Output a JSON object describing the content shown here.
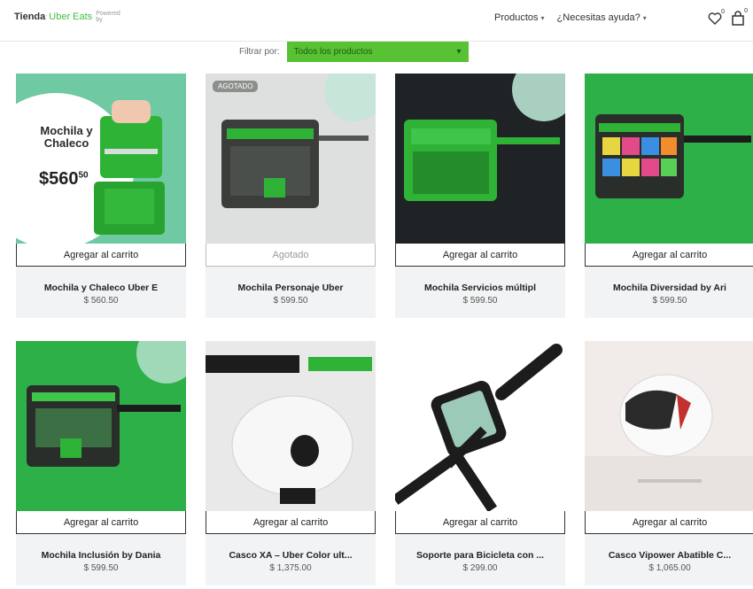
{
  "header": {
    "logo_brand": "Tienda",
    "logo_accent": "Uber Eats",
    "logo_tag": "Powered by",
    "nav": [
      {
        "label": "Productos"
      },
      {
        "label": "¿Necesitas ayuda?"
      }
    ],
    "cart_count": "0"
  },
  "filter": {
    "label": "Filtrar por:",
    "value": "Todos los productos"
  },
  "products": [
    {
      "name": "Mochila y Chaleco Uber E",
      "price": "$ 560.50",
      "button": "Agregar al carrito",
      "disabled": false,
      "badge": "",
      "poster_title": "Mochila y Chaleco",
      "poster_price": "$560",
      "poster_cents": "50"
    },
    {
      "name": "Mochila Personaje Uber",
      "price": "$ 599.50",
      "button": "Agotado",
      "disabled": true,
      "badge": "AGOTADO"
    },
    {
      "name": "Mochila Servicios múltipl",
      "price": "$ 599.50",
      "button": "Agregar al carrito",
      "disabled": false,
      "badge": ""
    },
    {
      "name": "Mochila Diversidad by Ari",
      "price": "$ 599.50",
      "button": "Agregar al carrito",
      "disabled": false,
      "badge": ""
    },
    {
      "name": "Mochila Inclusión by Dania",
      "price": "$ 599.50",
      "button": "Agregar al carrito",
      "disabled": false,
      "badge": ""
    },
    {
      "name": "Casco XA – Uber Color ult...",
      "price": "$ 1,375.00",
      "button": "Agregar al carrito",
      "disabled": false,
      "badge": ""
    },
    {
      "name": "Soporte para Bicicleta con ...",
      "price": "$ 299.00",
      "button": "Agregar al carrito",
      "disabled": false,
      "badge": ""
    },
    {
      "name": "Casco Vipower Abatible C...",
      "price": "$ 1,065.00",
      "button": "Agregar al carrito",
      "disabled": false,
      "badge": ""
    }
  ],
  "colors": {
    "brand_green": "#57c233",
    "bag_green": "#2fb336",
    "dark_bg": "#1f2326",
    "info_bg": "#f2f3f4"
  }
}
